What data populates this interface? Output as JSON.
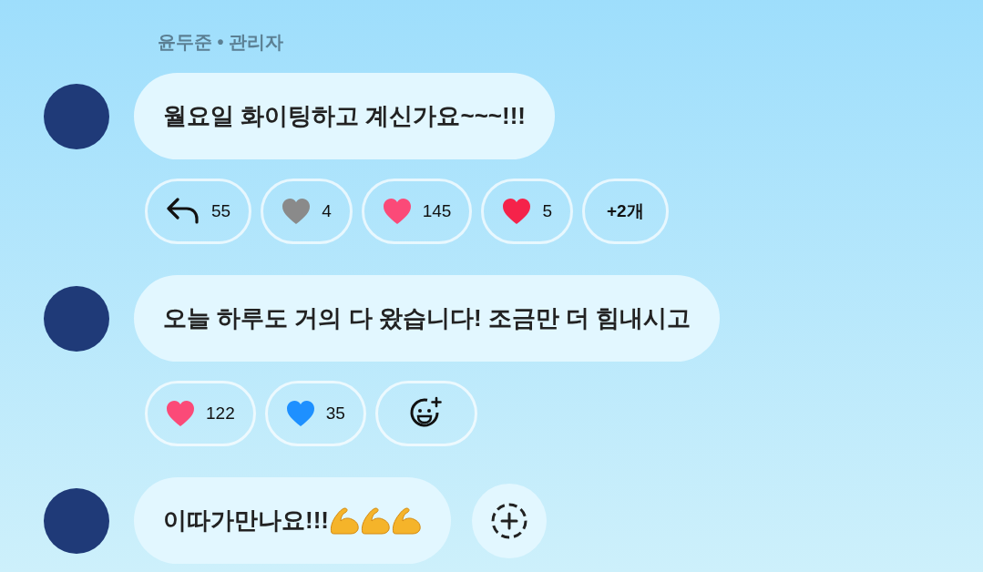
{
  "sender": {
    "name": "윤두준 • 관리자"
  },
  "messages": [
    {
      "text": "월요일 화이팅하고 계신가요~~~!!!",
      "reactions": [
        {
          "kind": "reply",
          "count": "55"
        },
        {
          "kind": "heart",
          "color": "#8a8a8a",
          "count": "4"
        },
        {
          "kind": "heart",
          "color": "#fb4a78",
          "count": "145"
        },
        {
          "kind": "heart",
          "color": "#f5234a",
          "count": "5"
        },
        {
          "kind": "more",
          "label": "+2개"
        }
      ]
    },
    {
      "text": "오늘 하루도 거의 다 왔습니다! 조금만 더 힘내시고",
      "reactions": [
        {
          "kind": "heart",
          "color": "#fb4a78",
          "count": "122"
        },
        {
          "kind": "heart",
          "color": "#1e90ff",
          "count": "35"
        },
        {
          "kind": "add-emoji"
        }
      ]
    },
    {
      "text": "이따가만나요!!!",
      "emojis": [
        {
          "kind": "flexed-biceps"
        },
        {
          "kind": "flexed-biceps"
        },
        {
          "kind": "flexed-biceps"
        }
      ],
      "add_button": true
    }
  ]
}
